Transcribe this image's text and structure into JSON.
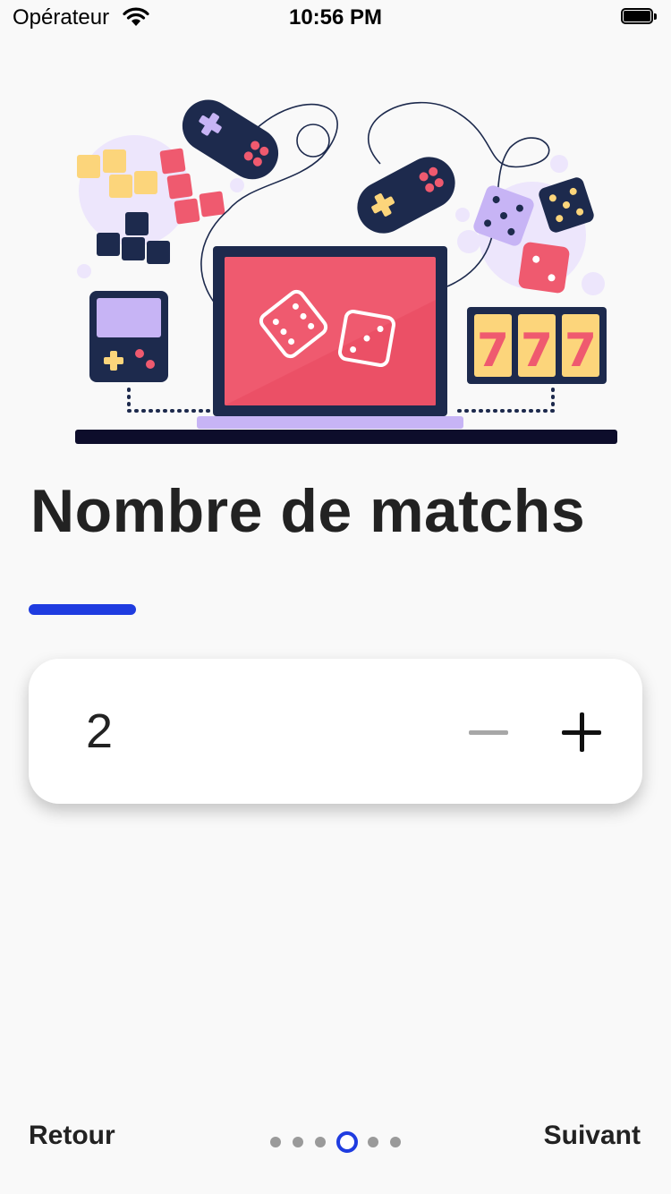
{
  "status_bar": {
    "carrier": "Opérateur",
    "time": "10:56 PM",
    "wifi_icon": "wifi-icon",
    "battery_icon": "battery-icon"
  },
  "illustration": {
    "icon": "gaming-illustration",
    "slot_digits": [
      "7",
      "7",
      "7"
    ]
  },
  "page_title": "Nombre de matchs",
  "stepper": {
    "value": "2",
    "decrement_icon": "minus-icon",
    "increment_icon": "plus-icon",
    "decrement_enabled": false
  },
  "nav": {
    "back_label": "Retour",
    "next_label": "Suivant",
    "page_count": 6,
    "current_page": 4
  },
  "colors": {
    "accent": "#1f3ce0",
    "background": "#f9f9f9",
    "title_text": "#222222",
    "disabled": "#a7a7a7"
  }
}
